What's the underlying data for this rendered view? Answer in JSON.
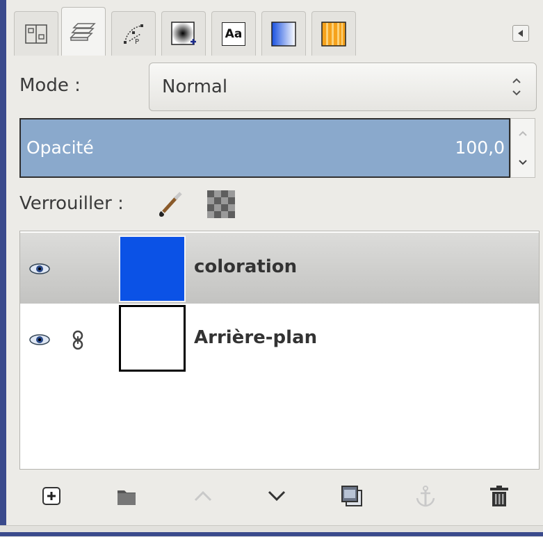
{
  "tabs": [
    {
      "icon": "tool-options-icon",
      "active": false
    },
    {
      "icon": "layers-icon",
      "active": true
    },
    {
      "icon": "paths-icon",
      "active": false
    },
    {
      "icon": "brush-icon",
      "active": false
    },
    {
      "icon": "fonts-icon",
      "label": "Aa",
      "active": false
    },
    {
      "icon": "gradient-blue-icon",
      "active": false
    },
    {
      "icon": "gradient-orange-icon",
      "active": false
    }
  ],
  "tab_menu_icon": "tab-menu-icon",
  "mode": {
    "label": "Mode :",
    "value": "Normal"
  },
  "opacity": {
    "label": "Opacité",
    "value": "100,0",
    "fill_color": "#8aa9cc"
  },
  "lock": {
    "label": "Verrouiller :",
    "pixels_icon": "paintbrush-lock-icon",
    "alpha_icon": "checkerboard-lock-icon"
  },
  "layers": [
    {
      "name": "coloration",
      "visible": true,
      "chained": false,
      "selected": true,
      "thumb_color": "#0b52e6"
    },
    {
      "name": "Arrière-plan",
      "visible": true,
      "chained": true,
      "selected": false,
      "thumb_color": "#ffffff"
    }
  ],
  "toolbar": [
    {
      "icon": "new-layer-icon",
      "enabled": true
    },
    {
      "icon": "new-layer-group-icon",
      "enabled": true
    },
    {
      "icon": "raise-layer-icon",
      "enabled": false
    },
    {
      "icon": "lower-layer-icon",
      "enabled": true
    },
    {
      "icon": "duplicate-layer-icon",
      "enabled": true
    },
    {
      "icon": "anchor-layer-icon",
      "enabled": false
    },
    {
      "icon": "delete-layer-icon",
      "enabled": true
    }
  ]
}
